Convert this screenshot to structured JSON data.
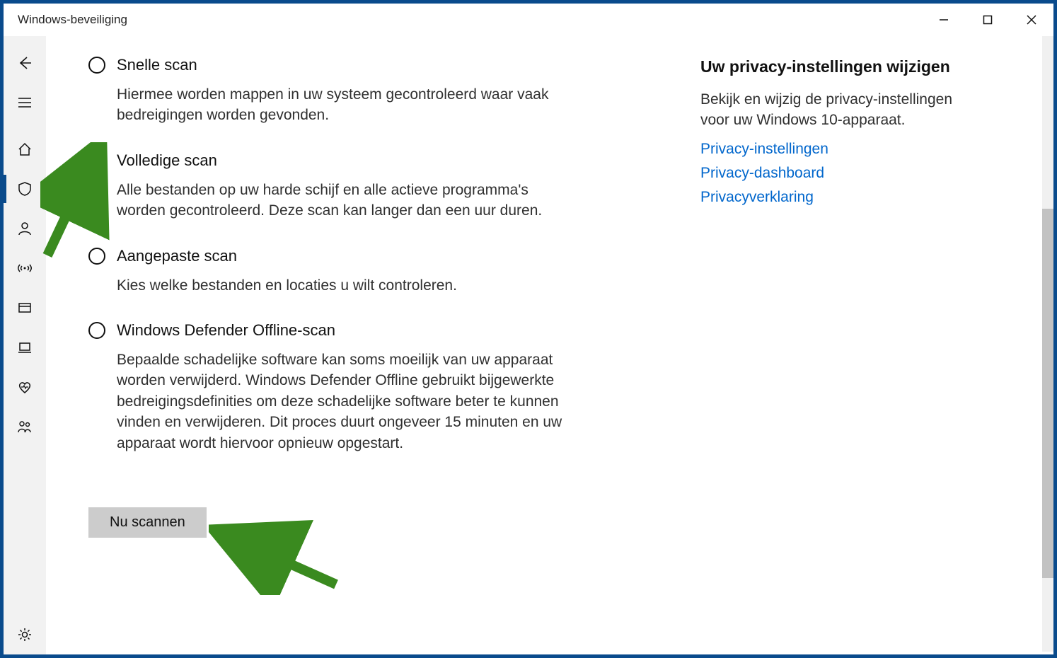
{
  "window": {
    "title": "Windows-beveiliging"
  },
  "sidebar": {
    "items": [
      "back",
      "menu",
      "home",
      "shield",
      "account",
      "antenna",
      "app",
      "device",
      "heart",
      "family",
      "settings"
    ]
  },
  "scan": {
    "options": [
      {
        "label": "Snelle scan",
        "desc": "Hiermee worden mappen in uw systeem gecontroleerd waar vaak bedreigingen worden gevonden."
      },
      {
        "label": "Volledige scan",
        "desc": "Alle bestanden op uw harde schijf en alle actieve programma's worden gecontroleerd. Deze scan kan langer dan een uur duren."
      },
      {
        "label": "Aangepaste scan",
        "desc": "Kies welke bestanden en locaties u wilt controleren."
      },
      {
        "label": "Windows Defender Offline-scan",
        "desc": "Bepaalde schadelijke software kan soms moeilijk van uw apparaat worden verwijderd. Windows Defender Offline gebruikt bijgewerkte bedreigingsdefinities om deze schadelijke software beter te kunnen vinden en verwijderen. Dit proces duurt ongeveer 15 minuten en uw apparaat wordt hiervoor opnieuw opgestart."
      }
    ],
    "selected_index": 1,
    "button_label": "Nu scannen"
  },
  "privacy": {
    "heading": "Uw privacy-instellingen wijzigen",
    "desc": "Bekijk en wijzig de privacy-instellingen voor uw Windows 10-apparaat.",
    "links": [
      "Privacy-instellingen",
      "Privacy-dashboard",
      "Privacyverklaring"
    ]
  }
}
